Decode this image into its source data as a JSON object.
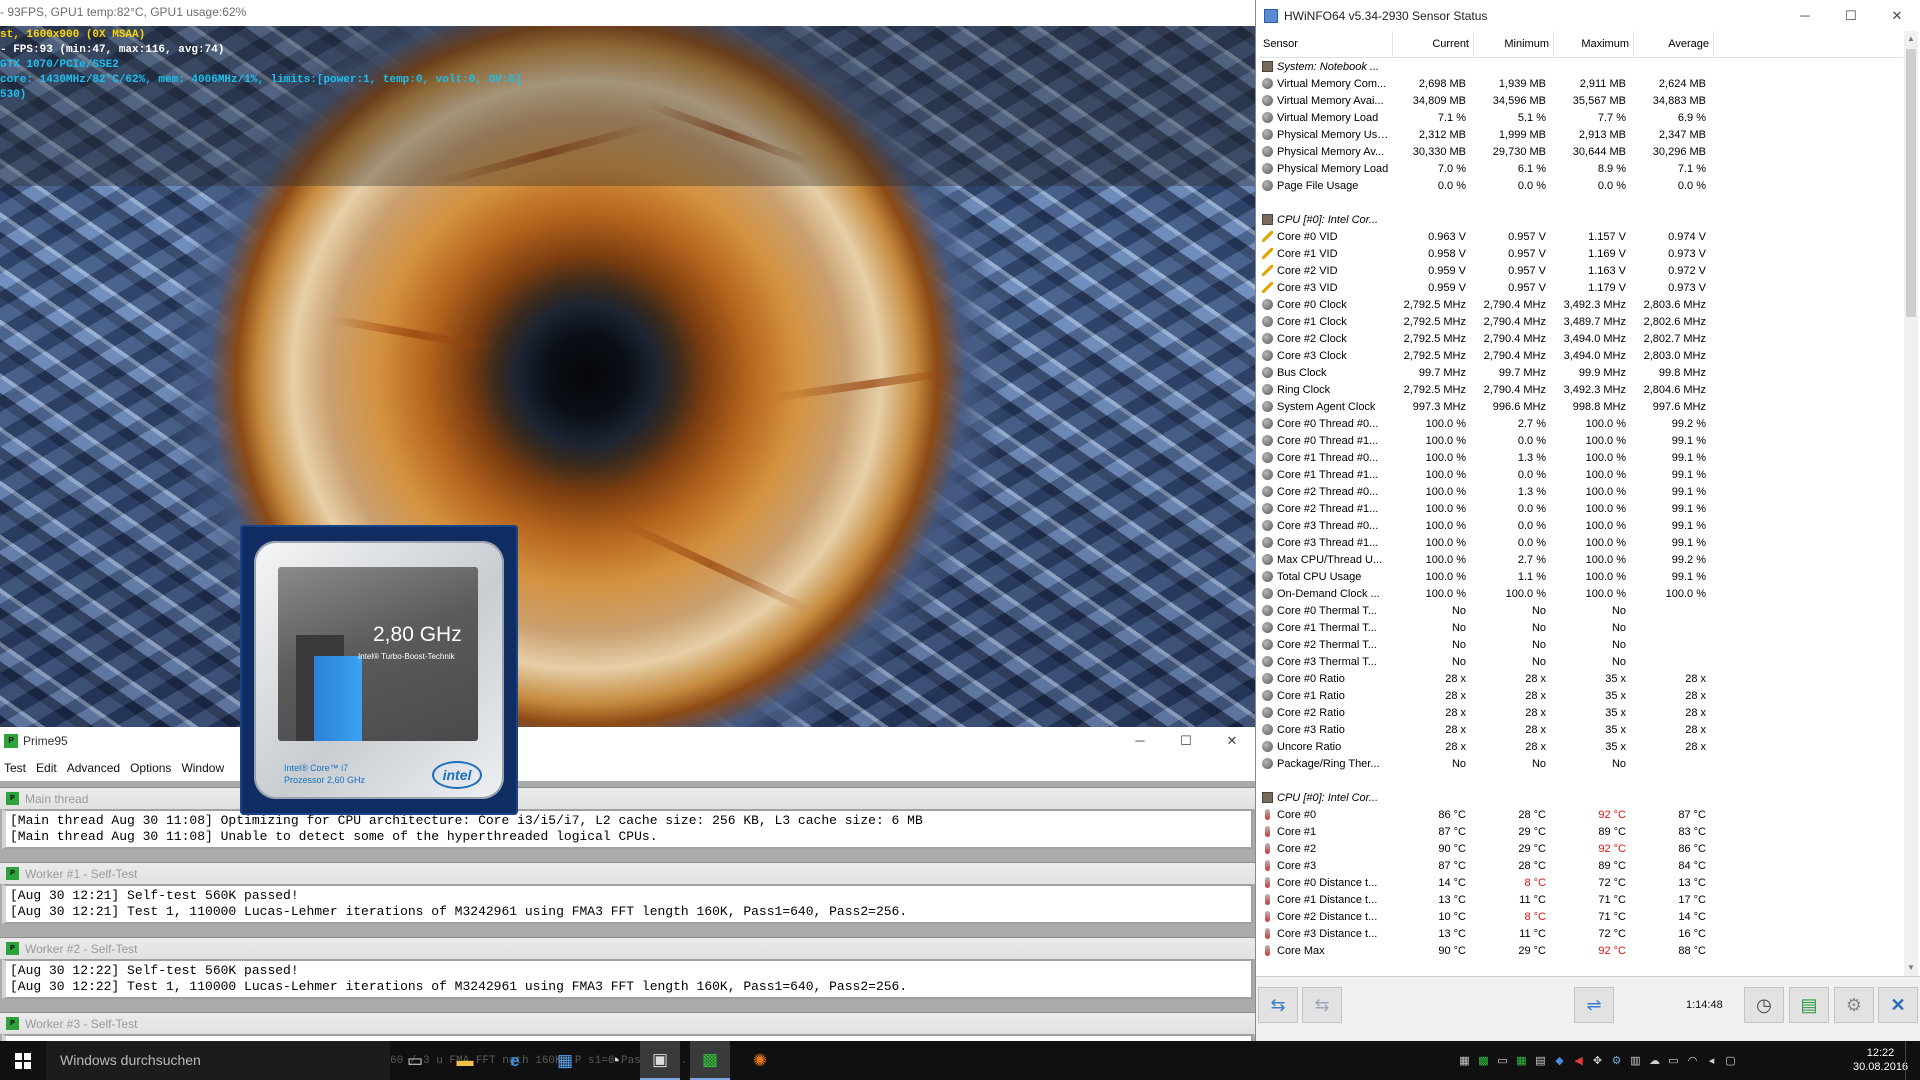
{
  "osd": {
    "fps_line": "- 93FPS, GPU1 temp:82°C, GPU1 usage:62%",
    "line1": "st, 1600x900 (0X MSAA)",
    "line2": "- FPS:93 (min:47, max:116, avg:74)",
    "line3": "GTX 1070/PCIe/SSE2",
    "line4": "core: 1430MHz/82°C/62%, mem: 4006MHz/1%, limits:[power:1, temp:0, volt:0, OV:0]",
    "line5": "530)"
  },
  "intel_badge": {
    "frequency": "2,80 GHz",
    "turbo": "Intel® Turbo-Boost-Technik",
    "brand": "Intel® Core™ i7",
    "processor": "Prozessor 2,60 GHz",
    "logo": "intel",
    "turbo_fill": 0.8
  },
  "prime95": {
    "title": "Prime95",
    "menu": [
      "Test",
      "Edit",
      "Advanced",
      "Options",
      "Window"
    ],
    "threads": [
      {
        "title": "Main thread",
        "lines": [
          "[Main thread Aug 30 11:08] Optimizing for CPU architecture: Core i3/i5/i7, L2 cache size: 256 KB, L3 cache size: 6 MB",
          "[Main thread Aug 30 11:08] Unable to detect some of the hyperthreaded logical CPUs."
        ]
      },
      {
        "title": "Worker #1 - Self-Test",
        "lines": [
          "[Aug 30 12:21] Self-test 560K passed!",
          "[Aug 30 12:21] Test 1, 110000 Lucas-Lehmer iterations of M3242961 using FMA3 FFT length 160K, Pass1=640, Pass2=256."
        ]
      },
      {
        "title": "Worker #2 - Self-Test",
        "lines": [
          "[Aug 30 12:22] Self-test 560K passed!",
          "[Aug 30 12:22] Test 1, 110000 Lucas-Lehmer iterations of M3242961 using FMA3 FFT length 160K, Pass1=640, Pass2=256."
        ]
      },
      {
        "title": "Worker #3 - Self-Test",
        "lines": [
          "",
          ""
        ]
      }
    ]
  },
  "hwinfo": {
    "title": "HWiNFO64 v5.34-2930 Sensor Status",
    "columns": [
      "Sensor",
      "Current",
      "Minimum",
      "Maximum",
      "Average"
    ],
    "elapsed": "1:14:48",
    "accent": "#e01010",
    "rows": [
      {
        "type": "group",
        "icon": "chip",
        "label": "System: Notebook ..."
      },
      {
        "type": "row",
        "icon": "circle",
        "label": "Virtual Memory Com...",
        "cur": "2,698 MB",
        "min": "1,939 MB",
        "max": "2,911 MB",
        "avg": "2,624 MB"
      },
      {
        "type": "row",
        "icon": "circle",
        "label": "Virtual Memory Avai...",
        "cur": "34,809 MB",
        "min": "34,596 MB",
        "max": "35,567 MB",
        "avg": "34,883 MB"
      },
      {
        "type": "row",
        "icon": "circle",
        "label": "Virtual Memory Load",
        "cur": "7.1 %",
        "min": "5.1 %",
        "max": "7.7 %",
        "avg": "6.9 %"
      },
      {
        "type": "row",
        "icon": "circle",
        "label": "Physical Memory Used",
        "cur": "2,312 MB",
        "min": "1,999 MB",
        "max": "2,913 MB",
        "avg": "2,347 MB"
      },
      {
        "type": "row",
        "icon": "circle",
        "label": "Physical Memory Av...",
        "cur": "30,330 MB",
        "min": "29,730 MB",
        "max": "30,644 MB",
        "avg": "30,296 MB"
      },
      {
        "type": "row",
        "icon": "circle",
        "label": "Physical Memory Load",
        "cur": "7.0 %",
        "min": "6.1 %",
        "max": "8.9 %",
        "avg": "7.1 %"
      },
      {
        "type": "row",
        "icon": "circle",
        "label": "Page File Usage",
        "cur": "0.0 %",
        "min": "0.0 %",
        "max": "0.0 %",
        "avg": "0.0 %"
      },
      {
        "type": "gap"
      },
      {
        "type": "group",
        "icon": "chip",
        "label": "CPU [#0]: Intel Cor..."
      },
      {
        "type": "row",
        "icon": "volt",
        "label": "Core #0 VID",
        "cur": "0.963 V",
        "min": "0.957 V",
        "max": "1.157 V",
        "avg": "0.974 V"
      },
      {
        "type": "row",
        "icon": "volt",
        "label": "Core #1 VID",
        "cur": "0.958 V",
        "min": "0.957 V",
        "max": "1.169 V",
        "avg": "0.973 V"
      },
      {
        "type": "row",
        "icon": "volt",
        "label": "Core #2 VID",
        "cur": "0.959 V",
        "min": "0.957 V",
        "max": "1.163 V",
        "avg": "0.972 V"
      },
      {
        "type": "row",
        "icon": "volt",
        "label": "Core #3 VID",
        "cur": "0.959 V",
        "min": "0.957 V",
        "max": "1.179 V",
        "avg": "0.973 V"
      },
      {
        "type": "row",
        "icon": "circle",
        "label": "Core #0 Clock",
        "cur": "2,792.5 MHz",
        "min": "2,790.4 MHz",
        "max": "3,492.3 MHz",
        "avg": "2,803.6 MHz"
      },
      {
        "type": "row",
        "icon": "circle",
        "label": "Core #1 Clock",
        "cur": "2,792.5 MHz",
        "min": "2,790.4 MHz",
        "max": "3,489.7 MHz",
        "avg": "2,802.6 MHz"
      },
      {
        "type": "row",
        "icon": "circle",
        "label": "Core #2 Clock",
        "cur": "2,792.5 MHz",
        "min": "2,790.4 MHz",
        "max": "3,494.0 MHz",
        "avg": "2,802.7 MHz"
      },
      {
        "type": "row",
        "icon": "circle",
        "label": "Core #3 Clock",
        "cur": "2,792.5 MHz",
        "min": "2,790.4 MHz",
        "max": "3,494.0 MHz",
        "avg": "2,803.0 MHz"
      },
      {
        "type": "row",
        "icon": "circle",
        "label": "Bus Clock",
        "cur": "99.7 MHz",
        "min": "99.7 MHz",
        "max": "99.9 MHz",
        "avg": "99.8 MHz"
      },
      {
        "type": "row",
        "icon": "circle",
        "label": "Ring Clock",
        "cur": "2,792.5 MHz",
        "min": "2,790.4 MHz",
        "max": "3,492.3 MHz",
        "avg": "2,804.6 MHz"
      },
      {
        "type": "row",
        "icon": "circle",
        "label": "System Agent Clock",
        "cur": "997.3 MHz",
        "min": "996.6 MHz",
        "max": "998.8 MHz",
        "avg": "997.6 MHz"
      },
      {
        "type": "row",
        "icon": "circle",
        "label": "Core #0 Thread #0...",
        "cur": "100.0 %",
        "min": "2.7 %",
        "max": "100.0 %",
        "avg": "99.2 %"
      },
      {
        "type": "row",
        "icon": "circle",
        "label": "Core #0 Thread #1...",
        "cur": "100.0 %",
        "min": "0.0 %",
        "max": "100.0 %",
        "avg": "99.1 %"
      },
      {
        "type": "row",
        "icon": "circle",
        "label": "Core #1 Thread #0...",
        "cur": "100.0 %",
        "min": "1.3 %",
        "max": "100.0 %",
        "avg": "99.1 %"
      },
      {
        "type": "row",
        "icon": "circle",
        "label": "Core #1 Thread #1...",
        "cur": "100.0 %",
        "min": "0.0 %",
        "max": "100.0 %",
        "avg": "99.1 %"
      },
      {
        "type": "row",
        "icon": "circle",
        "label": "Core #2 Thread #0...",
        "cur": "100.0 %",
        "min": "1.3 %",
        "max": "100.0 %",
        "avg": "99.1 %"
      },
      {
        "type": "row",
        "icon": "circle",
        "label": "Core #2 Thread #1...",
        "cur": "100.0 %",
        "min": "0.0 %",
        "max": "100.0 %",
        "avg": "99.1 %"
      },
      {
        "type": "row",
        "icon": "circle",
        "label": "Core #3 Thread #0...",
        "cur": "100.0 %",
        "min": "0.0 %",
        "max": "100.0 %",
        "avg": "99.1 %"
      },
      {
        "type": "row",
        "icon": "circle",
        "label": "Core #3 Thread #1...",
        "cur": "100.0 %",
        "min": "0.0 %",
        "max": "100.0 %",
        "avg": "99.1 %"
      },
      {
        "type": "row",
        "icon": "circle",
        "label": "Max CPU/Thread U...",
        "cur": "100.0 %",
        "min": "2.7 %",
        "max": "100.0 %",
        "avg": "99.2 %"
      },
      {
        "type": "row",
        "icon": "circle",
        "label": "Total CPU Usage",
        "cur": "100.0 %",
        "min": "1.1 %",
        "max": "100.0 %",
        "avg": "99.1 %"
      },
      {
        "type": "row",
        "icon": "circle",
        "label": "On-Demand Clock ...",
        "cur": "100.0 %",
        "min": "100.0 %",
        "max": "100.0 %",
        "avg": "100.0 %"
      },
      {
        "type": "row",
        "icon": "circle",
        "label": "Core #0 Thermal T...",
        "cur": "No",
        "min": "No",
        "max": "No",
        "avg": ""
      },
      {
        "type": "row",
        "icon": "circle",
        "label": "Core #1 Thermal T...",
        "cur": "No",
        "min": "No",
        "max": "No",
        "avg": ""
      },
      {
        "type": "row",
        "icon": "circle",
        "label": "Core #2 Thermal T...",
        "cur": "No",
        "min": "No",
        "max": "No",
        "avg": ""
      },
      {
        "type": "row",
        "icon": "circle",
        "label": "Core #3 Thermal T...",
        "cur": "No",
        "min": "No",
        "max": "No",
        "avg": ""
      },
      {
        "type": "row",
        "icon": "circle",
        "label": "Core #0 Ratio",
        "cur": "28 x",
        "min": "28 x",
        "max": "35 x",
        "avg": "28 x"
      },
      {
        "type": "row",
        "icon": "circle",
        "label": "Core #1 Ratio",
        "cur": "28 x",
        "min": "28 x",
        "max": "35 x",
        "avg": "28 x"
      },
      {
        "type": "row",
        "icon": "circle",
        "label": "Core #2 Ratio",
        "cur": "28 x",
        "min": "28 x",
        "max": "35 x",
        "avg": "28 x"
      },
      {
        "type": "row",
        "icon": "circle",
        "label": "Core #3 Ratio",
        "cur": "28 x",
        "min": "28 x",
        "max": "35 x",
        "avg": "28 x"
      },
      {
        "type": "row",
        "icon": "circle",
        "label": "Uncore Ratio",
        "cur": "28 x",
        "min": "28 x",
        "max": "35 x",
        "avg": "28 x"
      },
      {
        "type": "row",
        "icon": "circle",
        "label": "Package/Ring Ther...",
        "cur": "No",
        "min": "No",
        "max": "No",
        "avg": ""
      },
      {
        "type": "gap"
      },
      {
        "type": "group",
        "icon": "chip",
        "label": "CPU [#0]: Intel Cor..."
      },
      {
        "type": "row",
        "icon": "temp",
        "label": "Core #0",
        "cur": "86 °C",
        "min": "28 °C",
        "max": "92 °C",
        "avg": "87 °C",
        "red": [
          "max"
        ]
      },
      {
        "type": "row",
        "icon": "temp",
        "label": "Core #1",
        "cur": "87 °C",
        "min": "29 °C",
        "max": "89 °C",
        "avg": "83 °C"
      },
      {
        "type": "row",
        "icon": "temp",
        "label": "Core #2",
        "cur": "90 °C",
        "min": "29 °C",
        "max": "92 °C",
        "avg": "86 °C",
        "red": [
          "max"
        ]
      },
      {
        "type": "row",
        "icon": "temp",
        "label": "Core #3",
        "cur": "87 °C",
        "min": "28 °C",
        "max": "89 °C",
        "avg": "84 °C"
      },
      {
        "type": "row",
        "icon": "temp",
        "label": "Core #0 Distance t...",
        "cur": "14 °C",
        "min": "8 °C",
        "max": "72 °C",
        "avg": "13 °C",
        "red": [
          "min"
        ]
      },
      {
        "type": "row",
        "icon": "temp",
        "label": "Core #1 Distance t...",
        "cur": "13 °C",
        "min": "11 °C",
        "max": "71 °C",
        "avg": "17 °C"
      },
      {
        "type": "row",
        "icon": "temp",
        "label": "Core #2 Distance t...",
        "cur": "10 °C",
        "min": "8 °C",
        "max": "71 °C",
        "avg": "14 °C",
        "red": [
          "min"
        ]
      },
      {
        "type": "row",
        "icon": "temp",
        "label": "Core #3 Distance t...",
        "cur": "13 °C",
        "min": "11 °C",
        "max": "72 °C",
        "avg": "16 °C"
      },
      {
        "type": "row",
        "icon": "temp",
        "label": "Core Max",
        "cur": "90 °C",
        "min": "29 °C",
        "max": "92 °C",
        "avg": "88 °C",
        "red": [
          "max"
        ]
      }
    ],
    "toolbar_icons": [
      "nav-arrows-icon",
      "nav-arrows-disabled-icon",
      "network-icon",
      "clock-icon",
      "report-add-icon",
      "settings-icon",
      "close-icon"
    ]
  },
  "taskbar": {
    "search_placeholder": "Windows durchsuchen",
    "ghost_text": "60 / 3 u  FMA  FFT  ngth 160K, P  s1=6  Pass2=256.",
    "time": "12:22",
    "date": "30.08.2016",
    "pinned": [
      "task-view-icon",
      "file-explorer-icon",
      "edge-icon",
      "store-icon",
      "control-icon",
      "terminal-icon",
      "hwinfo-icon",
      "furmark-icon"
    ]
  }
}
